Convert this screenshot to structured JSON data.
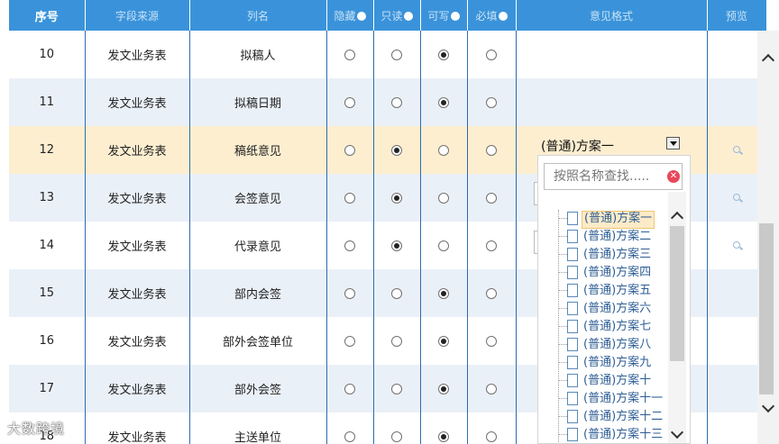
{
  "header": {
    "seq": "序号",
    "source": "字段来源",
    "column": "列名",
    "hidden": "隐藏",
    "readonly": "只读",
    "writable": "可写",
    "required": "必填",
    "format": "意见格式",
    "preview": "预览"
  },
  "rows": [
    {
      "seq": "10",
      "source": "发文业务表",
      "column": "拟稿人",
      "state": "writable"
    },
    {
      "seq": "11",
      "source": "发文业务表",
      "column": "拟稿日期",
      "state": "writable"
    },
    {
      "seq": "12",
      "source": "发文业务表",
      "column": "稿纸意见",
      "state": "readonly",
      "selected": true
    },
    {
      "seq": "13",
      "source": "发文业务表",
      "column": "会签意见",
      "state": "readonly"
    },
    {
      "seq": "14",
      "source": "发文业务表",
      "column": "代录意见",
      "state": "readonly"
    },
    {
      "seq": "15",
      "source": "发文业务表",
      "column": "部内会签",
      "state": "writable"
    },
    {
      "seq": "16",
      "source": "发文业务表",
      "column": "部外会签单位",
      "state": "writable"
    },
    {
      "seq": "17",
      "source": "发文业务表",
      "column": "部外会签",
      "state": "writable"
    },
    {
      "seq": "18",
      "source": "发文业务表",
      "column": "主送单位",
      "state": "writable"
    }
  ],
  "format_select": {
    "value": "(普通)方案一",
    "search_placeholder": "按照名称查找.....",
    "options": [
      "(普通)方案一",
      "(普通)方案二",
      "(普通)方案三",
      "(普通)方案四",
      "(普通)方案五",
      "(普通)方案六",
      "(普通)方案七",
      "(普通)方案八",
      "(普通)方案九",
      "(普通)方案十",
      "(普通)方案十一",
      "(普通)方案十二",
      "(普通)方案十三"
    ],
    "highlighted_index": 0
  },
  "watermark": "大数跨境",
  "icons": {
    "preview": "magnifier-icon",
    "dropdown": "chevron-down-icon",
    "clear": "close-icon",
    "option": "document-icon",
    "scroll_up": "chevron-up-icon",
    "scroll_down": "chevron-down-icon"
  },
  "colors": {
    "header_bg": "#3a93da",
    "selected_row": "#fdeed0",
    "alt_row": "#eaf0f7",
    "grid_line": "#2d6bb0"
  }
}
